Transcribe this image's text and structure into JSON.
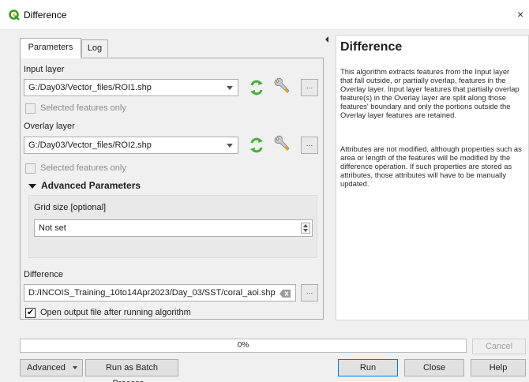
{
  "window": {
    "title": "Difference",
    "close_glyph": "×"
  },
  "tabs": [
    {
      "label": "Parameters"
    },
    {
      "label": "Log"
    }
  ],
  "params": {
    "input_layer": {
      "label": "Input layer",
      "value": "G:/Day03/Vector_files/ROI1.shp",
      "selected_only_label": "Selected features only",
      "selected_only_checked": false
    },
    "overlay_layer": {
      "label": "Overlay layer",
      "value": "G:/Day03/Vector_files/ROI2.shp",
      "selected_only_label": "Selected features only",
      "selected_only_checked": false
    },
    "advanced": {
      "header": "Advanced Parameters",
      "expanded": true,
      "grid_size_label": "Grid size [optional]",
      "grid_size_value": "Not set"
    },
    "output": {
      "label": "Difference",
      "value": "D:/INCOIS_Training_10to14Apr2023/Day_03/SST/coral_aoi.shp",
      "open_after_label": "Open output file after running algorithm",
      "open_after_checked": true
    },
    "more_button": "…"
  },
  "help": {
    "title": "Difference",
    "paragraph1": "This algorithm extracts features from the Input layer that fall outside, or partially overlap, features in the Overlay layer. Input layer features that partially overlap feature(s) in the Overlay layer are split along those features' boundary and only the portions outside the Overlay layer features are retained.",
    "paragraph2": "Attributes are not modified, although properties such as area or length of the features will be modified by the difference operation. If such properties are stored as attributes, those attributes will have to be manually updated."
  },
  "progress": {
    "percent": 0,
    "text": "0%"
  },
  "buttons": {
    "advanced": "Advanced",
    "batch": "Run as Batch Process...",
    "run": "Run",
    "close": "Close",
    "help": "Help",
    "cancel": "Cancel"
  },
  "icons": {
    "app": "qgis-logo-icon",
    "iterate": "iterate-icon",
    "settings": "wrench-icon",
    "clear": "clear-icon",
    "dropdown": "chevron-down-icon"
  },
  "colors": {
    "qgis_green": "#3a9d23",
    "iterate_green": "#45b03a",
    "focus_blue": "#0078d7"
  }
}
